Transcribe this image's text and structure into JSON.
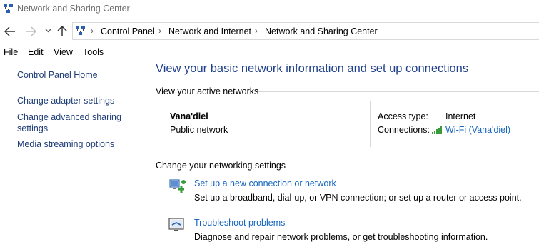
{
  "window": {
    "title": "Network and Sharing Center"
  },
  "nav": {
    "back_icon": "arrow-left-icon",
    "forward_icon": "arrow-right-icon",
    "recent_icon": "chevron-down-icon",
    "up_icon": "arrow-up-icon",
    "breadcrumb": [
      "Control Panel",
      "Network and Internet",
      "Network and Sharing Center"
    ]
  },
  "menu": [
    "File",
    "Edit",
    "View",
    "Tools"
  ],
  "sidebar": {
    "items": [
      {
        "label": "Control Panel Home"
      },
      {
        "label": "Change adapter settings"
      },
      {
        "label": "Change advanced sharing"
      },
      {
        "label": "settings"
      },
      {
        "label": "Media streaming options"
      }
    ]
  },
  "main": {
    "title": "View your basic network information and set up connections",
    "active_networks_heading": "View your active networks",
    "network": {
      "name": "Vana'diel",
      "category": "Public network",
      "access_type_label": "Access type:",
      "access_type_value": "Internet",
      "connections_label": "Connections:",
      "connection_link": "Wi-Fi (Vana'diel)"
    },
    "settings_heading": "Change your networking settings",
    "tasks": [
      {
        "link": "Set up a new connection or network",
        "description": "Set up a broadband, dial-up, or VPN connection; or set up a router or access point."
      },
      {
        "link": "Troubleshoot problems",
        "description": "Diagnose and repair network problems, or get troubleshooting information."
      }
    ]
  },
  "colors": {
    "link": "#1565c0",
    "title": "#1e3f8a",
    "sidebar_link": "#1f3d78",
    "wifi": "#3a9b3a"
  }
}
